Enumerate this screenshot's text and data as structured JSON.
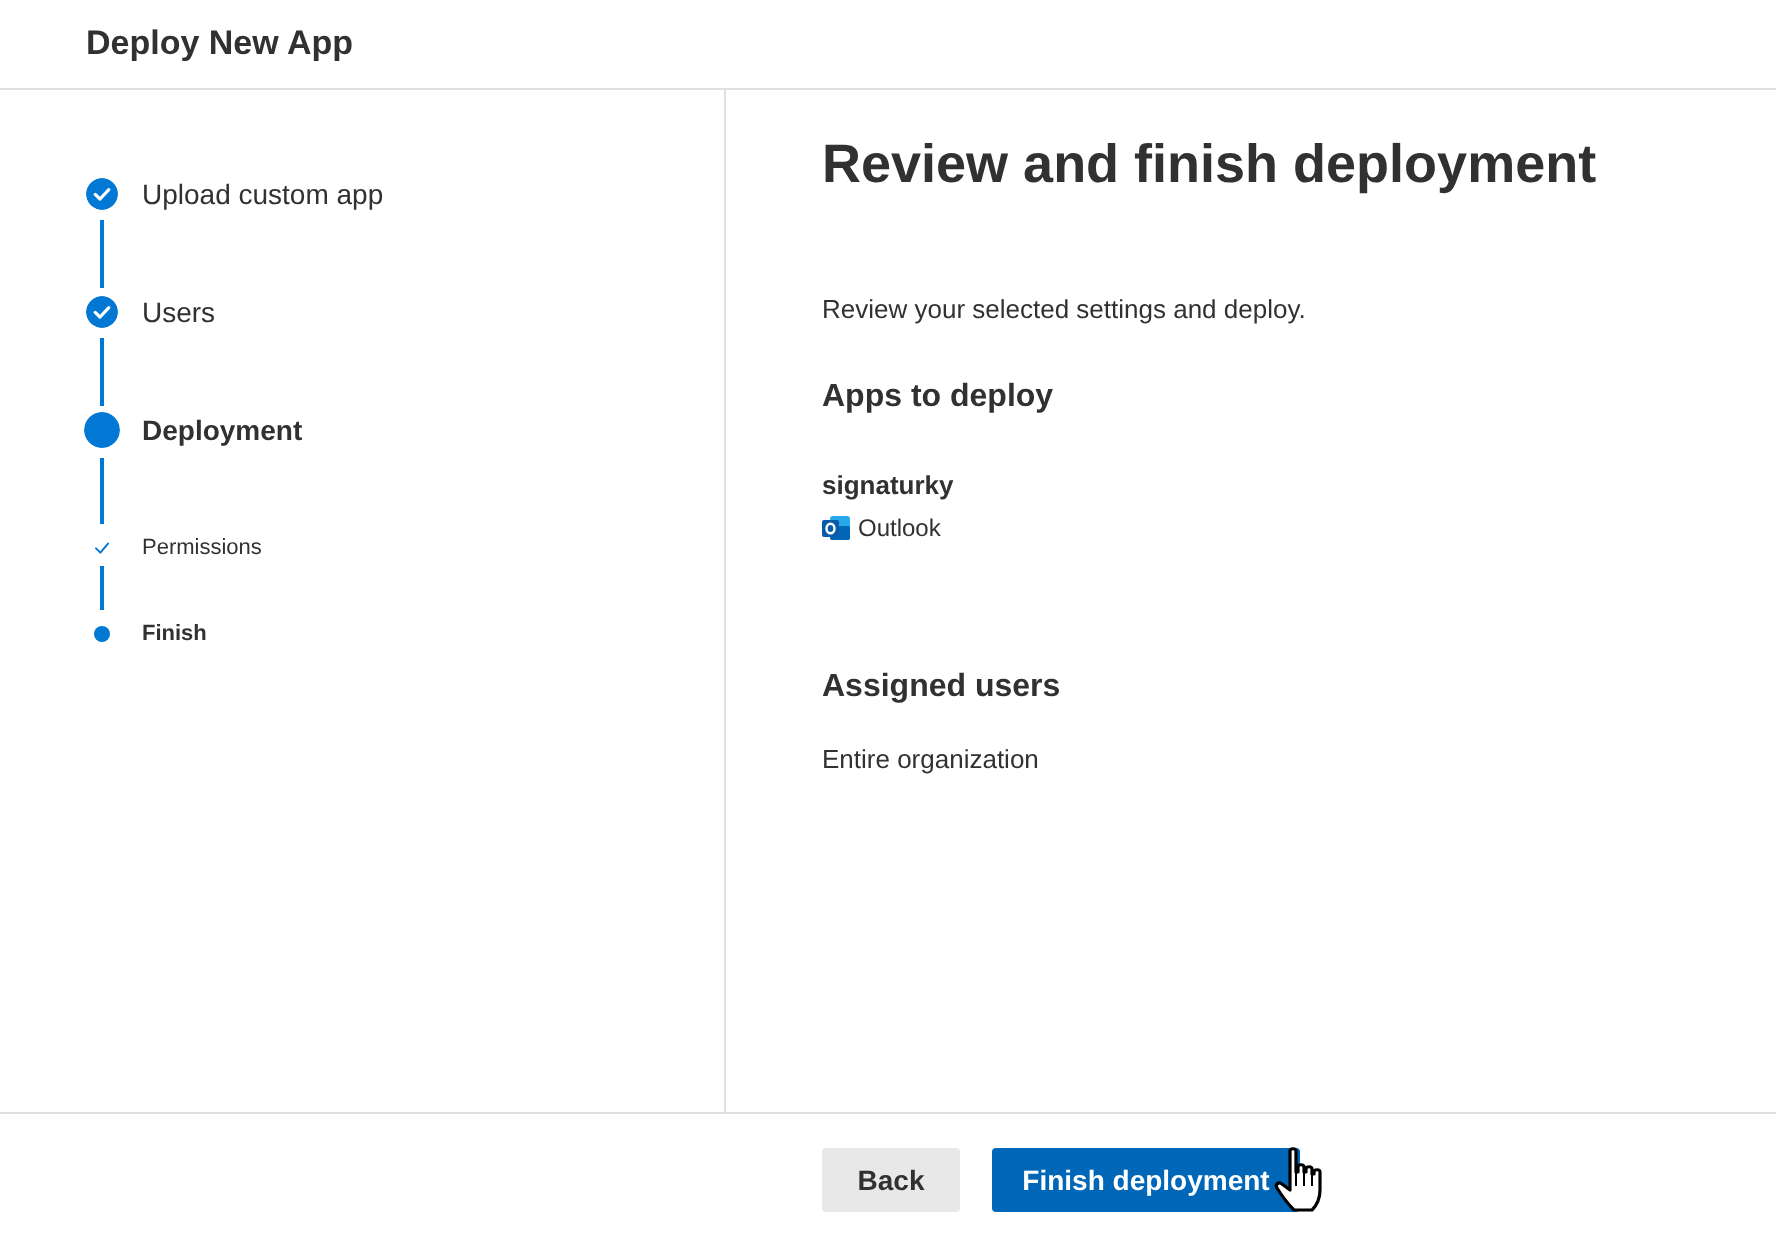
{
  "window": {
    "title": "Deploy New App"
  },
  "steps": [
    {
      "label": "Upload custom app",
      "kind": "step",
      "completed": true,
      "selected": false
    },
    {
      "label": "Users",
      "kind": "step",
      "completed": true,
      "selected": false
    },
    {
      "label": "Deployment",
      "kind": "step",
      "completed": false,
      "selected": true
    },
    {
      "label": "Permissions",
      "kind": "substep",
      "completed": true,
      "selected": false
    },
    {
      "label": "Finish",
      "kind": "substep",
      "completed": false,
      "selected": true
    }
  ],
  "content": {
    "heading": "Review and finish deployment",
    "intro": "Review your selected settings and deploy.",
    "sections": [
      {
        "title": "Apps to deploy",
        "kind": "apps",
        "apps": [
          {
            "name": "signaturky",
            "hosts": [
              {
                "label": "Outlook"
              }
            ]
          }
        ]
      },
      {
        "title": "Assigned users",
        "kind": "text",
        "text": "Entire organization"
      }
    ]
  },
  "buttons": [
    {
      "label": "Back",
      "kind": "secondary"
    },
    {
      "label": "Finish deployment",
      "kind": "primary"
    }
  ]
}
